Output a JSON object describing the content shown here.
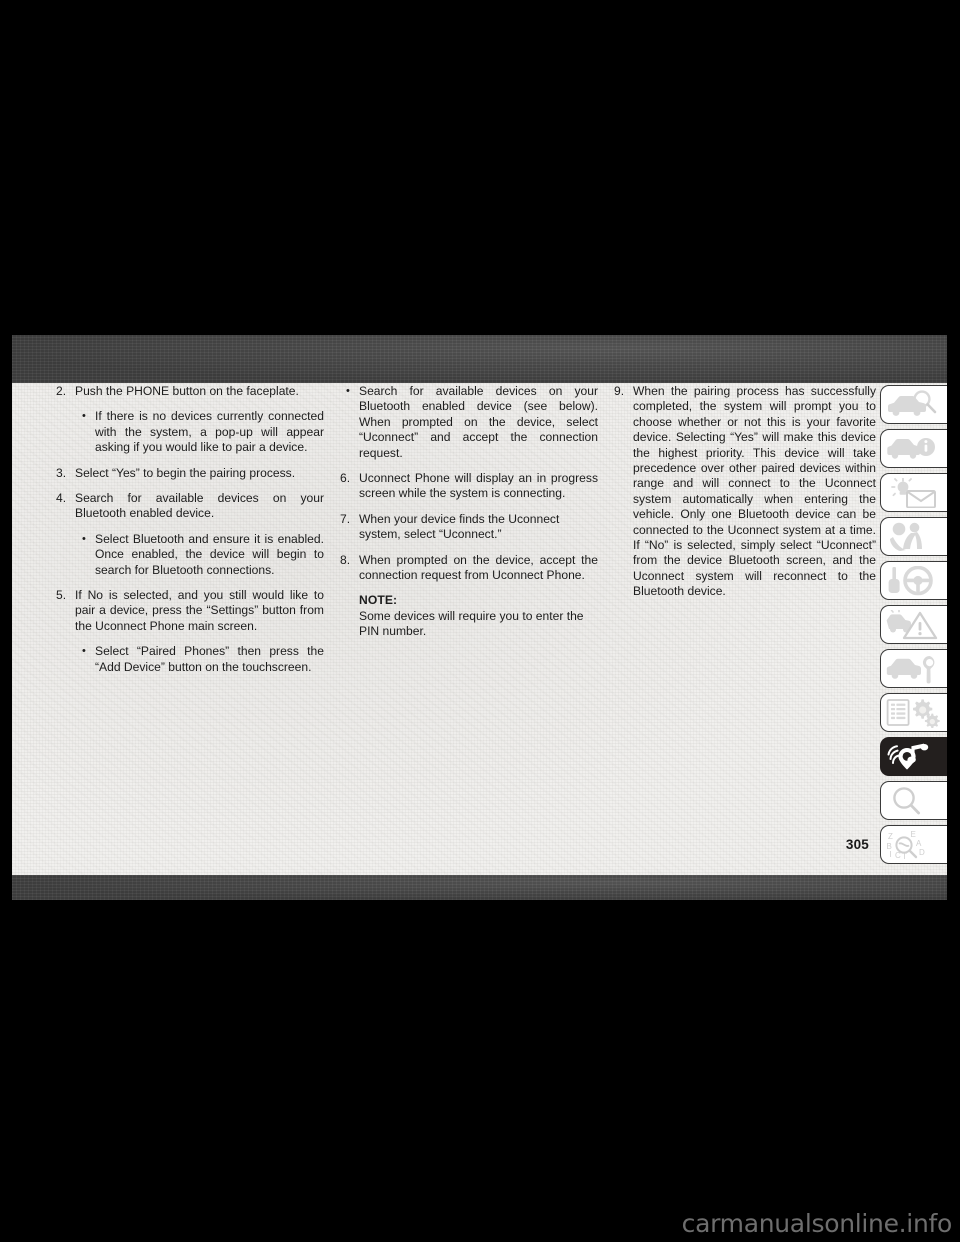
{
  "document": {
    "page_number": "305",
    "watermark": "carmanualsonline.info"
  },
  "columns": [
    {
      "id": "column-1",
      "items": [
        {
          "type": "numbered",
          "marker": "2.",
          "text": "Push the PHONE button on the faceplate."
        },
        {
          "type": "bullet",
          "marker": "•",
          "text": "If there is no devices currently connected with the system, a pop-up will appear asking if you would like to pair a device."
        },
        {
          "type": "numbered",
          "marker": "3.",
          "text": "Select “Yes” to begin the pairing process."
        },
        {
          "type": "numbered",
          "marker": "4.",
          "text": "Search for available devices on your Bluetooth enabled device."
        },
        {
          "type": "bullet",
          "marker": "•",
          "text": "Select Bluetooth and ensure it is enabled. Once enabled, the device will begin to search for Bluetooth connections."
        },
        {
          "type": "numbered",
          "marker": "5.",
          "text": "If No is selected, and you still would like to pair a device, press the “Settings” button from the Uconnect Phone main screen."
        },
        {
          "type": "bullet",
          "marker": "•",
          "text": "Select “Paired Phones” then press the “Add Device” button on the touchscreen."
        }
      ]
    },
    {
      "id": "column-2",
      "items": [
        {
          "type": "bullet",
          "marker": "•",
          "text": "Search for available devices on your Bluetooth enabled device (see below). When prompted on the device, select “Uconnect” and accept the connection request."
        },
        {
          "type": "numbered",
          "marker": "6.",
          "text": "Uconnect Phone will display an in progress screen while the system is connecting."
        },
        {
          "type": "numbered",
          "marker": "7.",
          "text": "When your device finds the Uconnect system, select “Uconnect.”"
        },
        {
          "type": "numbered",
          "marker": "8.",
          "text": "When prompted on the device, accept the connection request from Uconnect Phone."
        }
      ],
      "note": {
        "label": "NOTE:",
        "text": "Some devices will require you to enter the PIN number."
      }
    },
    {
      "id": "column-3",
      "items": [
        {
          "type": "numbered",
          "marker": "9.",
          "text": "When the pairing process has successfully completed, the system will prompt you to choose whether or not this is your favorite device. Selecting “Yes” will make this device the highest priority. This device will take precedence over other paired devices within range and will connect to the Uconnect system automatically when entering the vehicle. Only one Bluetooth device can be connected to the Uconnect system at a time. If “No” is selected, simply select “Uconnect” from the device Bluetooth screen, and the Uconnect system will reconnect to the Bluetooth device."
        }
      ]
    }
  ],
  "side_tabs": [
    {
      "id": "tab-vehicle-overview",
      "icon": "car-magnifier-icon",
      "active": false
    },
    {
      "id": "tab-vehicle-info",
      "icon": "car-info-icon",
      "active": false
    },
    {
      "id": "tab-lights-messages",
      "icon": "light-envelope-icon",
      "active": false
    },
    {
      "id": "tab-safety",
      "icon": "seatbelt-airbag-icon",
      "active": false
    },
    {
      "id": "tab-starting-operating",
      "icon": "key-steering-wheel-icon",
      "active": false
    },
    {
      "id": "tab-emergency",
      "icon": "car-warning-triangle-icon",
      "active": false
    },
    {
      "id": "tab-maintenance",
      "icon": "car-wrench-icon",
      "active": false
    },
    {
      "id": "tab-specifications",
      "icon": "document-gears-icon",
      "active": false
    },
    {
      "id": "tab-multimedia",
      "icon": "audio-multimedia-icon",
      "active": true
    },
    {
      "id": "tab-search",
      "icon": "magnifier-icon",
      "active": false
    },
    {
      "id": "tab-index",
      "icon": "index-letters-magnifier-icon",
      "active": false
    }
  ],
  "colors": {
    "paper": "#f1f0ee",
    "band": "#4b4b4b",
    "text": "#1c1c1c",
    "active_tab": "#231f1e",
    "tab_glyph": "#d9d9d9",
    "watermark": "#6e6e6e"
  }
}
